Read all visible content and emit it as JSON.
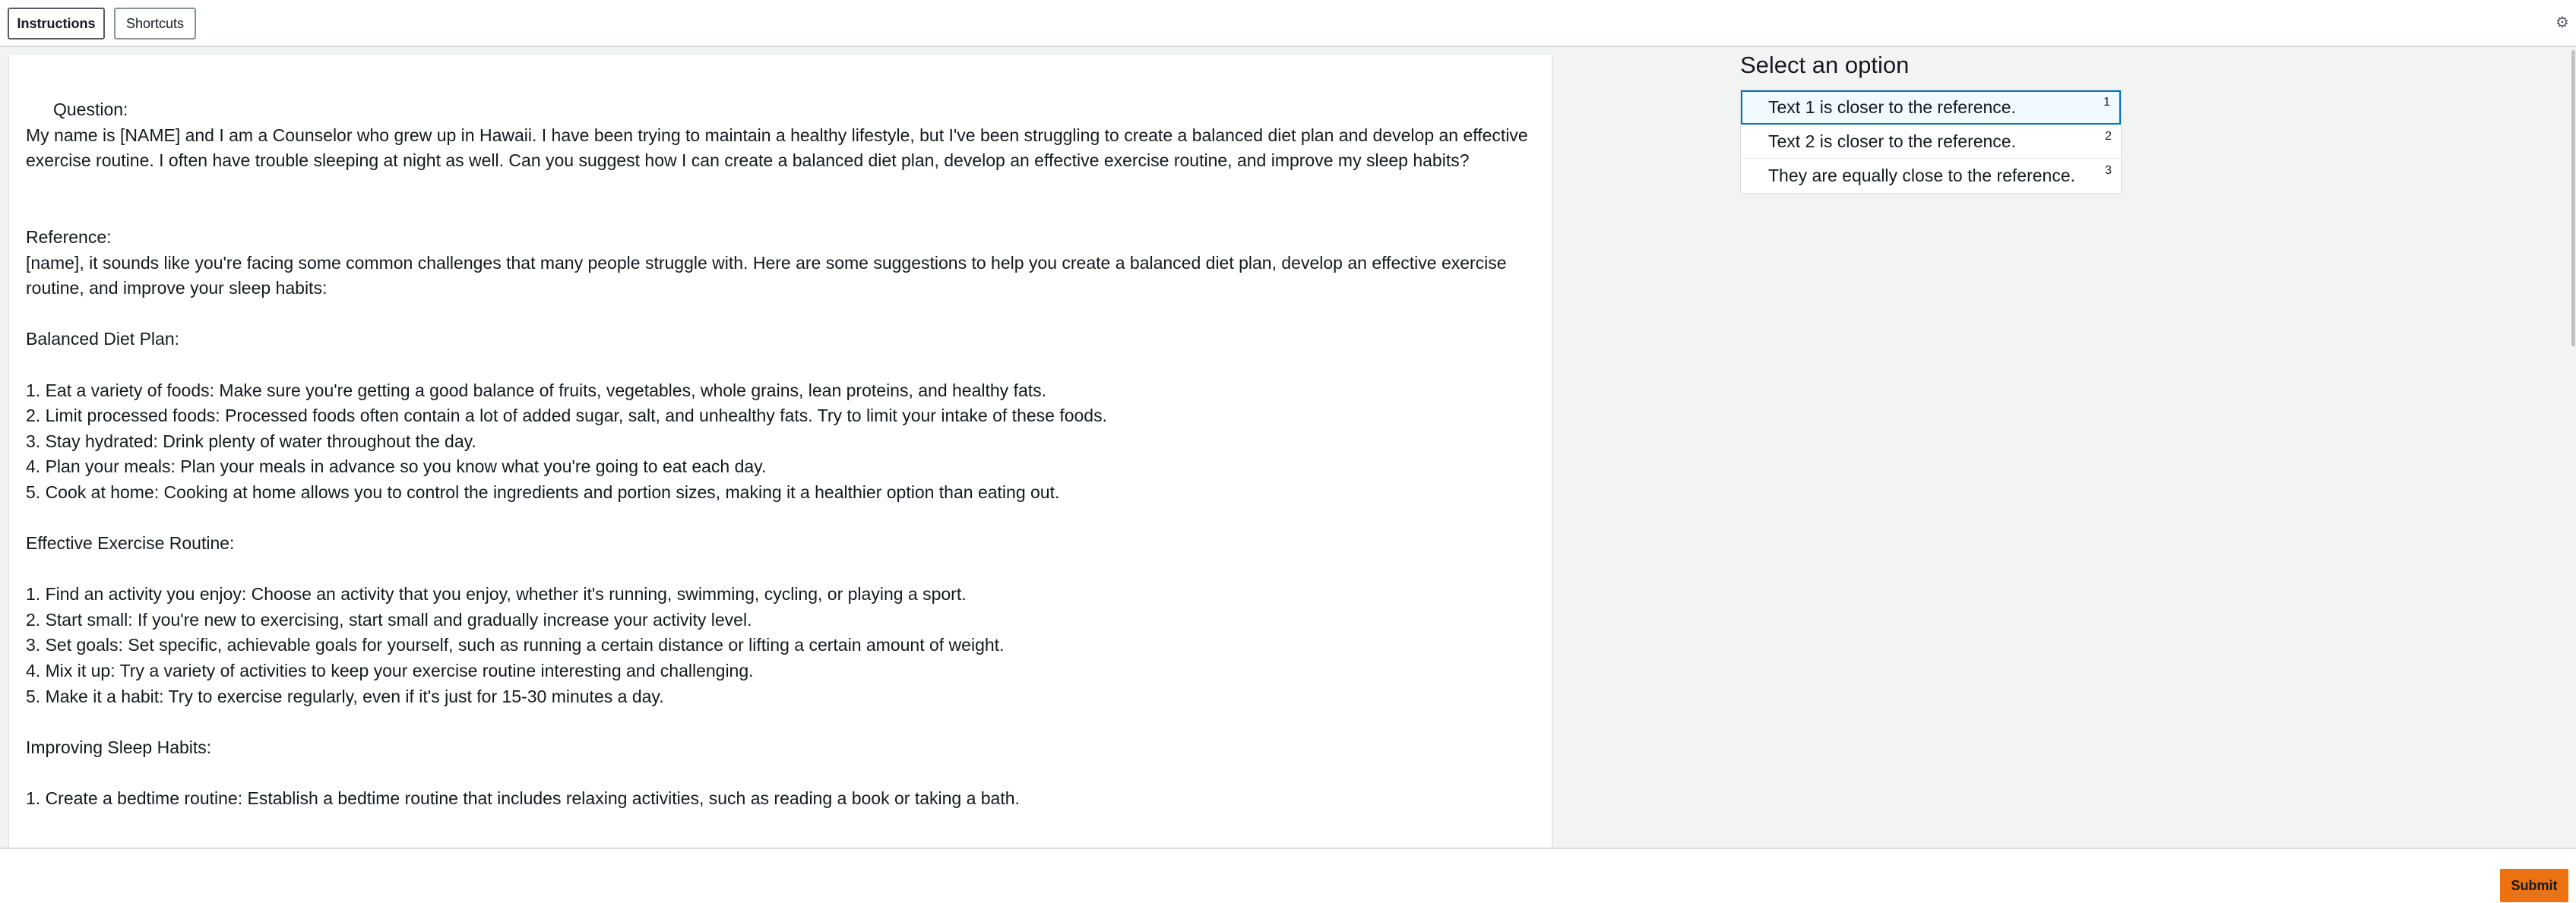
{
  "header": {
    "tabs": [
      {
        "label": "Instructions"
      },
      {
        "label": "Shortcuts"
      }
    ],
    "settings_icon": "gear-icon"
  },
  "main": {
    "question_label": "Question:",
    "question_text": "My name is [NAME] and I am a Counselor who grew up in Hawaii. I have been trying to maintain a healthy lifestyle, but I've been struggling to create a balanced diet plan and develop an effective exercise routine. I often have trouble sleeping at night as well. Can you suggest how I can create a balanced diet plan, develop an effective exercise routine, and improve my sleep habits?",
    "reference_label": "Reference:",
    "reference_intro": "[name], it sounds like you're facing some common challenges that many people struggle with. Here are some suggestions to help you create a balanced diet plan, develop an effective exercise routine, and improve your sleep habits:",
    "diet_heading": "Balanced Diet Plan:",
    "diet_items": [
      "1. Eat a variety of foods: Make sure you're getting a good balance of fruits, vegetables, whole grains, lean proteins, and healthy fats.",
      "2. Limit processed foods: Processed foods often contain a lot of added sugar, salt, and unhealthy fats. Try to limit your intake of these foods.",
      "3. Stay hydrated: Drink plenty of water throughout the day.",
      "4. Plan your meals: Plan your meals in advance so you know what you're going to eat each day.",
      "5. Cook at home: Cooking at home allows you to control the ingredients and portion sizes, making it a healthier option than eating out."
    ],
    "exercise_heading": "Effective Exercise Routine:",
    "exercise_items": [
      "1. Find an activity you enjoy: Choose an activity that you enjoy, whether it's running, swimming, cycling, or playing a sport.",
      "2. Start small: If you're new to exercising, start small and gradually increase your activity level.",
      "3. Set goals: Set specific, achievable goals for yourself, such as running a certain distance or lifting a certain amount of weight.",
      "4. Mix it up: Try a variety of activities to keep your exercise routine interesting and challenging.",
      "5. Make it a habit: Try to exercise regularly, even if it's just for 15-30 minutes a day."
    ],
    "sleep_heading": "Improving Sleep Habits:",
    "sleep_items": [
      "1. Create a bedtime routine: Establish a bedtime routine that includes relaxing activities, such as reading a book or taking a bath."
    ]
  },
  "sidebar": {
    "title": "Select an option",
    "options": [
      {
        "label": "Text 1 is closer to the reference.",
        "key": "1"
      },
      {
        "label": "Text 2 is closer to the reference.",
        "key": "2"
      },
      {
        "label": "They are equally close to the reference.",
        "key": "3"
      }
    ]
  },
  "footer": {
    "submit_label": "Submit"
  },
  "colors": {
    "accent": "#0073bb",
    "submit": "#ec7211",
    "selected_bg": "#f1faff"
  }
}
